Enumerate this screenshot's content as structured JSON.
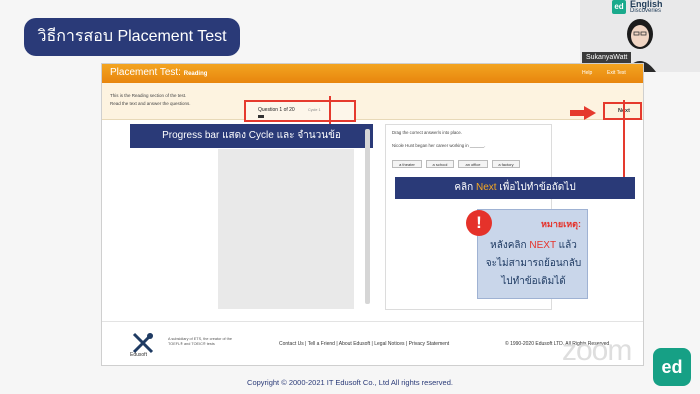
{
  "slide": {
    "title": "วิธีการสอบ Placement Test",
    "copyright": "Copyright © 2000-2021 IT Edusoft Co., Ltd All rights reserved."
  },
  "webcam": {
    "participant_name": "SukanyaWatt",
    "brand_line1": "English",
    "brand_line2": "Discoveries",
    "brand_icon": "ed"
  },
  "app": {
    "header_title": "Placement Test:",
    "header_section": "Reading",
    "help_label": "Help",
    "exit_label": "Exit Test",
    "sub_line1": "This is the Reading section of the test.",
    "sub_line2": "Read the text and answer the questions.",
    "question_label": "Question 1 of 20",
    "cycle_label": "Cycle 1",
    "progress": 0.05,
    "next_label": "Next",
    "instruction": "Drag the correct answer/s into place.",
    "question_text": "Nicole Hunt began her career working in ______.",
    "choices": [
      "a theater",
      "a school",
      "an office",
      "a factory"
    ]
  },
  "callouts": {
    "progress": "Progress bar แสดง Cycle และ จำนวนข้อ",
    "next_pre": "คลิก ",
    "next_hl": "Next",
    "next_post": " เพื่อไปทำข้อถัดไป",
    "note_title": "หมายเหตุ:",
    "note_l2_pre": "หลังคลิก ",
    "note_l2_hl": "NEXT",
    "note_l2_post": " แล้ว",
    "note_l3": "จะไม่สามารถย้อนกลับ",
    "note_l4": "ไปทำข้อเดิมได้"
  },
  "footer": {
    "logo_text": "Edusoft",
    "tagline": "A subsidiary of ETS, the creator of the TOEFL® and TOEIC® tests",
    "links": "Contact Us | Tell a Friend | About Edusoft | Legal Notices | Privacy Statement",
    "copyright": "© 1990-2020 Edusoft LTD. All Rights Reserved."
  },
  "overlay": {
    "zoom_watermark": "zoom",
    "zoom_badge": "ed"
  },
  "colors": {
    "accent_navy": "#2a3a78",
    "header_orange": "#e8850e",
    "highlight_red": "#e53a2e"
  }
}
